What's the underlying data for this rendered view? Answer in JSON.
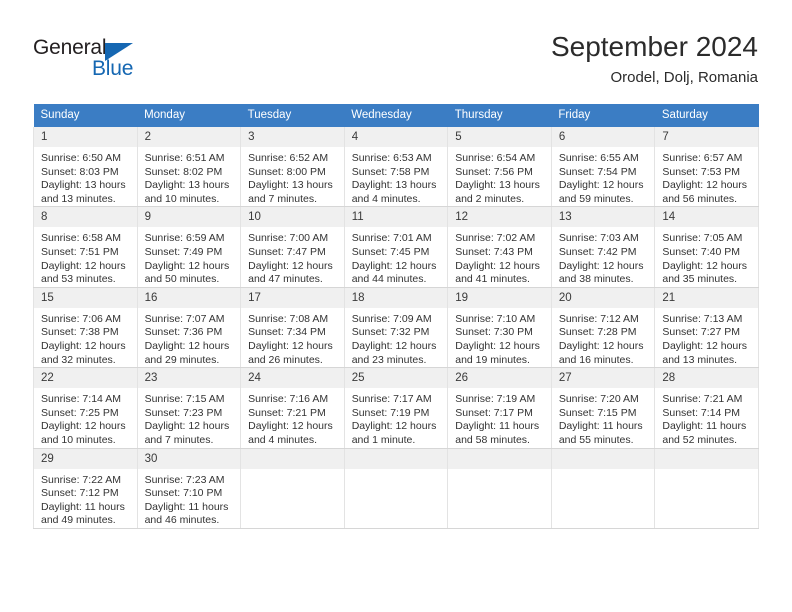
{
  "brand": {
    "name_part1": "General",
    "name_part2": "Blue",
    "accent_color": "#1567b2"
  },
  "header": {
    "month_title": "September 2024",
    "location": "Orodel, Dolj, Romania"
  },
  "calendar": {
    "header_color": "#3b7dc4",
    "weekdays": [
      "Sunday",
      "Monday",
      "Tuesday",
      "Wednesday",
      "Thursday",
      "Friday",
      "Saturday"
    ],
    "weeks": [
      [
        {
          "day": "1",
          "sunrise": "Sunrise: 6:50 AM",
          "sunset": "Sunset: 8:03 PM",
          "daylight_line1": "Daylight: 13 hours",
          "daylight_line2": "and 13 minutes."
        },
        {
          "day": "2",
          "sunrise": "Sunrise: 6:51 AM",
          "sunset": "Sunset: 8:02 PM",
          "daylight_line1": "Daylight: 13 hours",
          "daylight_line2": "and 10 minutes."
        },
        {
          "day": "3",
          "sunrise": "Sunrise: 6:52 AM",
          "sunset": "Sunset: 8:00 PM",
          "daylight_line1": "Daylight: 13 hours",
          "daylight_line2": "and 7 minutes."
        },
        {
          "day": "4",
          "sunrise": "Sunrise: 6:53 AM",
          "sunset": "Sunset: 7:58 PM",
          "daylight_line1": "Daylight: 13 hours",
          "daylight_line2": "and 4 minutes."
        },
        {
          "day": "5",
          "sunrise": "Sunrise: 6:54 AM",
          "sunset": "Sunset: 7:56 PM",
          "daylight_line1": "Daylight: 13 hours",
          "daylight_line2": "and 2 minutes."
        },
        {
          "day": "6",
          "sunrise": "Sunrise: 6:55 AM",
          "sunset": "Sunset: 7:54 PM",
          "daylight_line1": "Daylight: 12 hours",
          "daylight_line2": "and 59 minutes."
        },
        {
          "day": "7",
          "sunrise": "Sunrise: 6:57 AM",
          "sunset": "Sunset: 7:53 PM",
          "daylight_line1": "Daylight: 12 hours",
          "daylight_line2": "and 56 minutes."
        }
      ],
      [
        {
          "day": "8",
          "sunrise": "Sunrise: 6:58 AM",
          "sunset": "Sunset: 7:51 PM",
          "daylight_line1": "Daylight: 12 hours",
          "daylight_line2": "and 53 minutes."
        },
        {
          "day": "9",
          "sunrise": "Sunrise: 6:59 AM",
          "sunset": "Sunset: 7:49 PM",
          "daylight_line1": "Daylight: 12 hours",
          "daylight_line2": "and 50 minutes."
        },
        {
          "day": "10",
          "sunrise": "Sunrise: 7:00 AM",
          "sunset": "Sunset: 7:47 PM",
          "daylight_line1": "Daylight: 12 hours",
          "daylight_line2": "and 47 minutes."
        },
        {
          "day": "11",
          "sunrise": "Sunrise: 7:01 AM",
          "sunset": "Sunset: 7:45 PM",
          "daylight_line1": "Daylight: 12 hours",
          "daylight_line2": "and 44 minutes."
        },
        {
          "day": "12",
          "sunrise": "Sunrise: 7:02 AM",
          "sunset": "Sunset: 7:43 PM",
          "daylight_line1": "Daylight: 12 hours",
          "daylight_line2": "and 41 minutes."
        },
        {
          "day": "13",
          "sunrise": "Sunrise: 7:03 AM",
          "sunset": "Sunset: 7:42 PM",
          "daylight_line1": "Daylight: 12 hours",
          "daylight_line2": "and 38 minutes."
        },
        {
          "day": "14",
          "sunrise": "Sunrise: 7:05 AM",
          "sunset": "Sunset: 7:40 PM",
          "daylight_line1": "Daylight: 12 hours",
          "daylight_line2": "and 35 minutes."
        }
      ],
      [
        {
          "day": "15",
          "sunrise": "Sunrise: 7:06 AM",
          "sunset": "Sunset: 7:38 PM",
          "daylight_line1": "Daylight: 12 hours",
          "daylight_line2": "and 32 minutes."
        },
        {
          "day": "16",
          "sunrise": "Sunrise: 7:07 AM",
          "sunset": "Sunset: 7:36 PM",
          "daylight_line1": "Daylight: 12 hours",
          "daylight_line2": "and 29 minutes."
        },
        {
          "day": "17",
          "sunrise": "Sunrise: 7:08 AM",
          "sunset": "Sunset: 7:34 PM",
          "daylight_line1": "Daylight: 12 hours",
          "daylight_line2": "and 26 minutes."
        },
        {
          "day": "18",
          "sunrise": "Sunrise: 7:09 AM",
          "sunset": "Sunset: 7:32 PM",
          "daylight_line1": "Daylight: 12 hours",
          "daylight_line2": "and 23 minutes."
        },
        {
          "day": "19",
          "sunrise": "Sunrise: 7:10 AM",
          "sunset": "Sunset: 7:30 PM",
          "daylight_line1": "Daylight: 12 hours",
          "daylight_line2": "and 19 minutes."
        },
        {
          "day": "20",
          "sunrise": "Sunrise: 7:12 AM",
          "sunset": "Sunset: 7:28 PM",
          "daylight_line1": "Daylight: 12 hours",
          "daylight_line2": "and 16 minutes."
        },
        {
          "day": "21",
          "sunrise": "Sunrise: 7:13 AM",
          "sunset": "Sunset: 7:27 PM",
          "daylight_line1": "Daylight: 12 hours",
          "daylight_line2": "and 13 minutes."
        }
      ],
      [
        {
          "day": "22",
          "sunrise": "Sunrise: 7:14 AM",
          "sunset": "Sunset: 7:25 PM",
          "daylight_line1": "Daylight: 12 hours",
          "daylight_line2": "and 10 minutes."
        },
        {
          "day": "23",
          "sunrise": "Sunrise: 7:15 AM",
          "sunset": "Sunset: 7:23 PM",
          "daylight_line1": "Daylight: 12 hours",
          "daylight_line2": "and 7 minutes."
        },
        {
          "day": "24",
          "sunrise": "Sunrise: 7:16 AM",
          "sunset": "Sunset: 7:21 PM",
          "daylight_line1": "Daylight: 12 hours",
          "daylight_line2": "and 4 minutes."
        },
        {
          "day": "25",
          "sunrise": "Sunrise: 7:17 AM",
          "sunset": "Sunset: 7:19 PM",
          "daylight_line1": "Daylight: 12 hours",
          "daylight_line2": "and 1 minute."
        },
        {
          "day": "26",
          "sunrise": "Sunrise: 7:19 AM",
          "sunset": "Sunset: 7:17 PM",
          "daylight_line1": "Daylight: 11 hours",
          "daylight_line2": "and 58 minutes."
        },
        {
          "day": "27",
          "sunrise": "Sunrise: 7:20 AM",
          "sunset": "Sunset: 7:15 PM",
          "daylight_line1": "Daylight: 11 hours",
          "daylight_line2": "and 55 minutes."
        },
        {
          "day": "28",
          "sunrise": "Sunrise: 7:21 AM",
          "sunset": "Sunset: 7:14 PM",
          "daylight_line1": "Daylight: 11 hours",
          "daylight_line2": "and 52 minutes."
        }
      ],
      [
        {
          "day": "29",
          "sunrise": "Sunrise: 7:22 AM",
          "sunset": "Sunset: 7:12 PM",
          "daylight_line1": "Daylight: 11 hours",
          "daylight_line2": "and 49 minutes."
        },
        {
          "day": "30",
          "sunrise": "Sunrise: 7:23 AM",
          "sunset": "Sunset: 7:10 PM",
          "daylight_line1": "Daylight: 11 hours",
          "daylight_line2": "and 46 minutes."
        },
        {
          "day": "",
          "sunrise": "",
          "sunset": "",
          "daylight_line1": "",
          "daylight_line2": ""
        },
        {
          "day": "",
          "sunrise": "",
          "sunset": "",
          "daylight_line1": "",
          "daylight_line2": ""
        },
        {
          "day": "",
          "sunrise": "",
          "sunset": "",
          "daylight_line1": "",
          "daylight_line2": ""
        },
        {
          "day": "",
          "sunrise": "",
          "sunset": "",
          "daylight_line1": "",
          "daylight_line2": ""
        },
        {
          "day": "",
          "sunrise": "",
          "sunset": "",
          "daylight_line1": "",
          "daylight_line2": ""
        }
      ]
    ]
  }
}
